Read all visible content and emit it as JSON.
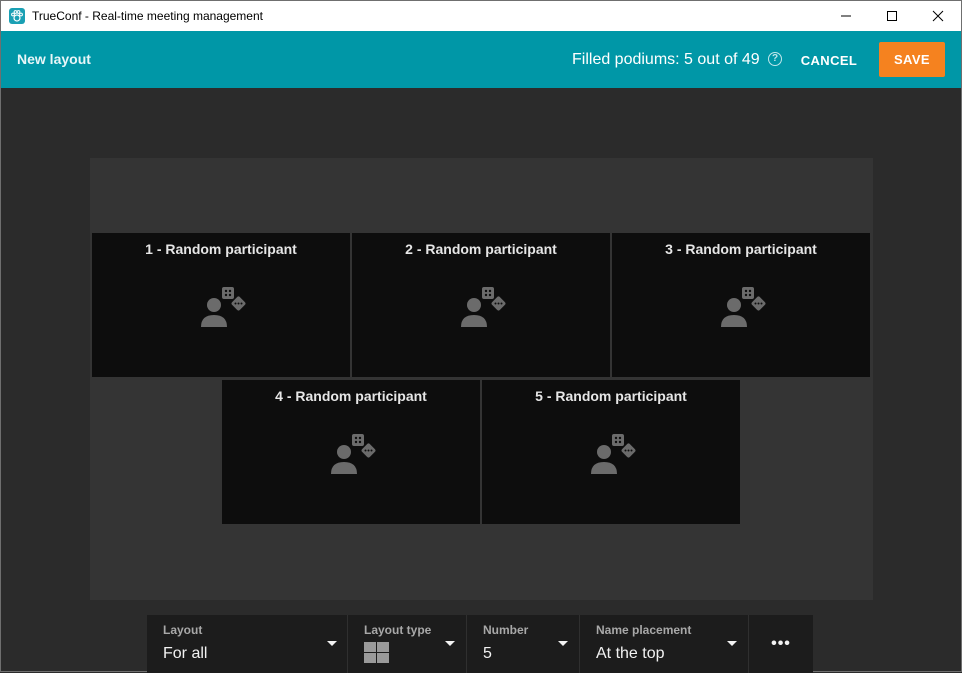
{
  "window": {
    "title": "TrueConf - Real-time meeting management",
    "app_icon": "trueconf-paw-icon",
    "controls": [
      "minimize",
      "maximize",
      "close"
    ]
  },
  "header": {
    "title": "New layout",
    "podiums_text": "Filled podiums: 5 out of 49",
    "help_glyph": "?",
    "cancel_label": "CANCEL",
    "save_label": "SAVE",
    "accent_color": "#0097a7",
    "save_color": "#f5821f"
  },
  "tiles": [
    {
      "label": "1 - Random participant",
      "icon": "random-participant-icon"
    },
    {
      "label": "2 - Random participant",
      "icon": "random-participant-icon"
    },
    {
      "label": "3 - Random participant",
      "icon": "random-participant-icon"
    },
    {
      "label": "4 - Random participant",
      "icon": "random-participant-icon"
    },
    {
      "label": "5 - Random participant",
      "icon": "random-participant-icon"
    }
  ],
  "toolbar": {
    "layout": {
      "label": "Layout",
      "value": "For all"
    },
    "layout_type": {
      "label": "Layout type",
      "value_icon": "grid-2x2-icon"
    },
    "number": {
      "label": "Number",
      "value": "5"
    },
    "name_placement": {
      "label": "Name placement",
      "value": "At the top"
    },
    "more": {
      "glyph": "•••"
    }
  }
}
